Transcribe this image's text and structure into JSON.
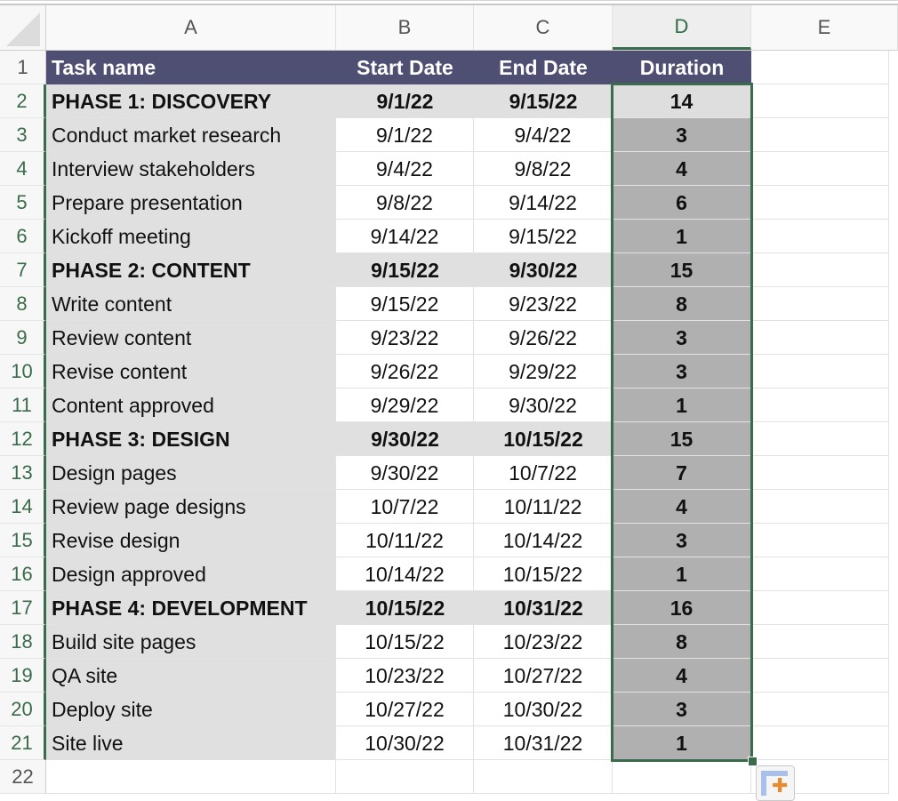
{
  "columns": [
    "A",
    "B",
    "C",
    "D",
    "E"
  ],
  "active_column": "D",
  "header_row": {
    "row_number": "1",
    "task": "Task name",
    "start": "Start Date",
    "end": "End Date",
    "duration": "Duration"
  },
  "rows": [
    {
      "row_number": "2",
      "task": "PHASE 1: DISCOVERY",
      "start": "9/1/22",
      "end": "9/15/22",
      "duration": "14",
      "phase": true
    },
    {
      "row_number": "3",
      "task": "Conduct market research",
      "start": "9/1/22",
      "end": "9/4/22",
      "duration": "3"
    },
    {
      "row_number": "4",
      "task": "Interview stakeholders",
      "start": "9/4/22",
      "end": "9/8/22",
      "duration": "4"
    },
    {
      "row_number": "5",
      "task": "Prepare presentation",
      "start": "9/8/22",
      "end": "9/14/22",
      "duration": "6"
    },
    {
      "row_number": "6",
      "task": "Kickoff meeting",
      "start": "9/14/22",
      "end": "9/15/22",
      "duration": "1"
    },
    {
      "row_number": "7",
      "task": "PHASE 2: CONTENT",
      "start": "9/15/22",
      "end": "9/30/22",
      "duration": "15",
      "phase": true
    },
    {
      "row_number": "8",
      "task": "Write content",
      "start": "9/15/22",
      "end": "9/23/22",
      "duration": "8"
    },
    {
      "row_number": "9",
      "task": "Review content",
      "start": "9/23/22",
      "end": "9/26/22",
      "duration": "3"
    },
    {
      "row_number": "10",
      "task": "Revise content",
      "start": "9/26/22",
      "end": "9/29/22",
      "duration": "3"
    },
    {
      "row_number": "11",
      "task": "Content approved",
      "start": "9/29/22",
      "end": "9/30/22",
      "duration": "1"
    },
    {
      "row_number": "12",
      "task": "PHASE 3: DESIGN",
      "start": "9/30/22",
      "end": "10/15/22",
      "duration": "15",
      "phase": true
    },
    {
      "row_number": "13",
      "task": "Design pages",
      "start": "9/30/22",
      "end": "10/7/22",
      "duration": "7"
    },
    {
      "row_number": "14",
      "task": "Review page designs",
      "start": "10/7/22",
      "end": "10/11/22",
      "duration": "4"
    },
    {
      "row_number": "15",
      "task": "Revise design",
      "start": "10/11/22",
      "end": "10/14/22",
      "duration": "3"
    },
    {
      "row_number": "16",
      "task": "Design approved",
      "start": "10/14/22",
      "end": "10/15/22",
      "duration": "1"
    },
    {
      "row_number": "17",
      "task": "PHASE 4: DEVELOPMENT",
      "start": "10/15/22",
      "end": "10/31/22",
      "duration": "16",
      "phase": true
    },
    {
      "row_number": "18",
      "task": "Build site pages",
      "start": "10/15/22",
      "end": "10/23/22",
      "duration": "8"
    },
    {
      "row_number": "19",
      "task": "QA site",
      "start": "10/23/22",
      "end": "10/27/22",
      "duration": "4"
    },
    {
      "row_number": "20",
      "task": "Deploy site",
      "start": "10/27/22",
      "end": "10/30/22",
      "duration": "3"
    },
    {
      "row_number": "21",
      "task": "Site live",
      "start": "10/30/22",
      "end": "10/31/22",
      "duration": "1"
    }
  ],
  "empty_row": {
    "row_number": "22"
  },
  "selection": {
    "range": "D2:D21",
    "active_cell": "D2"
  },
  "colors": {
    "header_fill": "#4e4f72",
    "phase_fill": "#e0e0e0",
    "selection_border": "#3a6b4a",
    "quick_analysis_accent": "#e88a2f"
  },
  "icons": {
    "quick_analysis": "quick-analysis-icon",
    "fill_handle": "fill-handle"
  }
}
